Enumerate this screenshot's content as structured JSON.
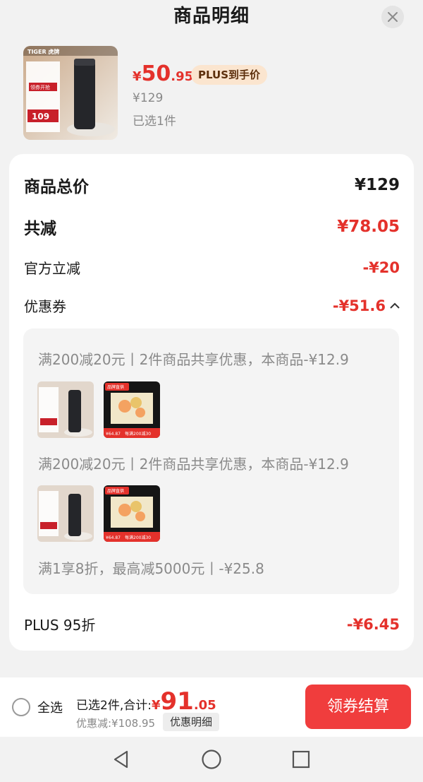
{
  "header": {
    "title": "商品明细"
  },
  "product": {
    "price_symbol": "¥",
    "price_int": "50",
    "price_dec": ".95",
    "plus_tag": "PLUS到手价",
    "original_price": "¥129",
    "selected_qty": "已选1件",
    "image_brand": "TIGER 虎牌",
    "image_promo_1": "领券开抢",
    "image_promo_2": "109"
  },
  "breakdown": {
    "total_label": "商品总价",
    "total_value": "¥129",
    "reduce_label": "共减",
    "reduce_value": "¥78.05",
    "official_label": "官方立减",
    "official_value": "-¥20",
    "coupon_label": "优惠券",
    "coupon_value": "-¥51.6",
    "plus_label": "PLUS 95折",
    "plus_value": "-¥6.45"
  },
  "coupons": [
    {
      "text": "满200减20元丨2件商品共享优惠，本商品-¥12.9"
    },
    {
      "text": "满200减20元丨2件商品共享优惠，本商品-¥12.9"
    },
    {
      "text": "满1享8折，最高减5000元丨-¥25.8"
    }
  ],
  "thumb2": {
    "top_label": "品牌直供",
    "bottom_price": "¥64.87",
    "bottom_label": "每满200减30"
  },
  "bottom": {
    "select_all": "全选",
    "total_label": "已选2件,合计:",
    "total_sym": "¥",
    "total_int": "91",
    "total_dec": ".05",
    "discount": "优惠减:¥108.95",
    "detail_button": "优惠明细",
    "checkout_button": "领券结算"
  },
  "colors": {
    "accent": "#e4312b",
    "checkout": "#f03d3d",
    "plus_tag_bg": "#fbe5cf"
  }
}
